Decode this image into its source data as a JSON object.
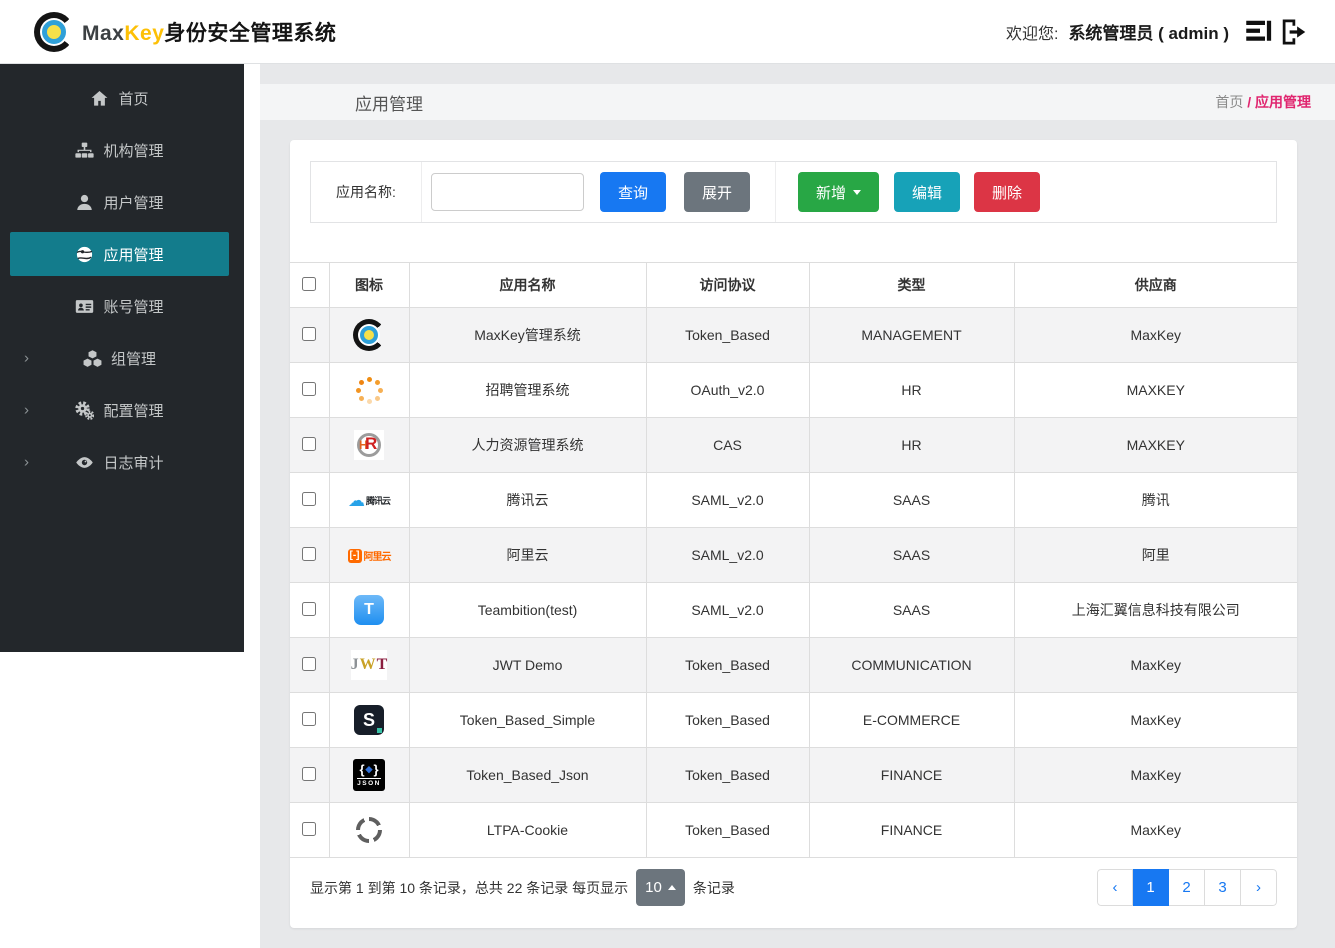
{
  "header": {
    "brand": {
      "max": "Max",
      "key": "Key",
      "suffix": "身份安全管理系统"
    },
    "welcome_label": "欢迎您:",
    "user": "系统管理员 ( admin )"
  },
  "sidebar": {
    "items": [
      {
        "key": "home",
        "icon": "home-icon",
        "label": "首页",
        "active": false,
        "expandable": false
      },
      {
        "key": "org",
        "icon": "sitemap-icon",
        "label": "机构管理",
        "active": false,
        "expandable": false
      },
      {
        "key": "user",
        "icon": "user-icon",
        "label": "用户管理",
        "active": false,
        "expandable": false
      },
      {
        "key": "app",
        "icon": "globe-icon",
        "label": "应用管理",
        "active": true,
        "expandable": false
      },
      {
        "key": "account",
        "icon": "id-card-icon",
        "label": "账号管理",
        "active": false,
        "expandable": false
      },
      {
        "key": "group",
        "icon": "cubes-icon",
        "label": "组管理",
        "active": false,
        "expandable": true
      },
      {
        "key": "config",
        "icon": "gears-icon",
        "label": "配置管理",
        "active": false,
        "expandable": true
      },
      {
        "key": "audit",
        "icon": "eye-icon",
        "label": "日志审计",
        "active": false,
        "expandable": true
      }
    ]
  },
  "page": {
    "title": "应用管理",
    "breadcrumb": {
      "home": "首页",
      "sep": "/",
      "current": "应用管理"
    }
  },
  "search": {
    "label": "应用名称:",
    "input_value": "",
    "query_label": "查询",
    "expand_label": "展开",
    "add_label": "新增",
    "edit_label": "编辑",
    "delete_label": "删除"
  },
  "table": {
    "headers": {
      "icon": "图标",
      "name": "应用名称",
      "protocol": "访问协议",
      "type": "类型",
      "vendor": "供应商"
    },
    "rows": [
      {
        "icon": "maxkey",
        "name": "MaxKey管理系统",
        "protocol": "Token_Based",
        "type": "MANAGEMENT",
        "vendor": "MaxKey"
      },
      {
        "icon": "dots",
        "name": "招聘管理系统",
        "protocol": "OAuth_v2.0",
        "type": "HR",
        "vendor": "MAXKEY"
      },
      {
        "icon": "hr",
        "name": "人力资源管理系统",
        "protocol": "CAS",
        "type": "HR",
        "vendor": "MAXKEY"
      },
      {
        "icon": "tencent",
        "name": "腾讯云",
        "protocol": "SAML_v2.0",
        "type": "SAAS",
        "vendor": "腾讯"
      },
      {
        "icon": "aliyun",
        "name": "阿里云",
        "protocol": "SAML_v2.0",
        "type": "SAAS",
        "vendor": "阿里"
      },
      {
        "icon": "teambition",
        "name": "Teambition(test)",
        "protocol": "SAML_v2.0",
        "type": "SAAS",
        "vendor": "上海汇翼信息科技有限公司"
      },
      {
        "icon": "jwt",
        "name": "JWT Demo",
        "protocol": "Token_Based",
        "type": "COMMUNICATION",
        "vendor": "MaxKey"
      },
      {
        "icon": "s",
        "name": "Token_Based_Simple",
        "protocol": "Token_Based",
        "type": "E-COMMERCE",
        "vendor": "MaxKey"
      },
      {
        "icon": "json",
        "name": "Token_Based_Json",
        "protocol": "Token_Based",
        "type": "FINANCE",
        "vendor": "MaxKey"
      },
      {
        "icon": "ltpa",
        "name": "LTPA-Cookie",
        "protocol": "Token_Based",
        "type": "FINANCE",
        "vendor": "MaxKey"
      }
    ]
  },
  "pagination": {
    "summary_prefix": "显示第 1 到第 10 条记录，总共 22 条记录  每页显示",
    "page_size": "10",
    "summary_suffix": "条记录",
    "prev": "‹",
    "next": "›",
    "pages": [
      "1",
      "2",
      "3"
    ],
    "active_page": "1"
  },
  "colors": {
    "accent_teal": "#137c8c",
    "primary_blue": "#1778f2",
    "success_green": "#28a745",
    "info_teal": "#17a2b8",
    "danger_red": "#dc3545",
    "secondary_gray": "#6c757d",
    "breadcrumb_pink": "#e0256f",
    "sidebar_dark": "#23272b"
  }
}
